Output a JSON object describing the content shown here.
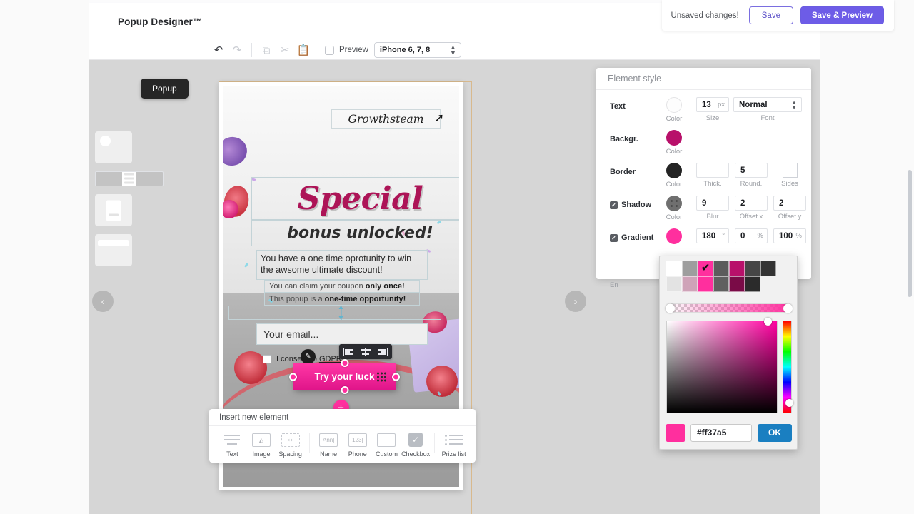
{
  "app": {
    "title": "Popup Designer™"
  },
  "toolbar": {
    "undo_icon": "undo-icon",
    "redo_icon": "redo-icon",
    "copy_icon": "copy-icon",
    "cut_icon": "cut-icon",
    "paste_icon": "paste-icon",
    "preview_label": "Preview",
    "device": "iPhone 6, 7, 8"
  },
  "savebar": {
    "status": "Unsaved changes!",
    "save_label": "Save",
    "save_preview_label": "Save & Preview",
    "accent": "#6d5ce7"
  },
  "rail": {
    "tooltip": "Popup",
    "prev_arrow": "‹",
    "next_arrow": "›"
  },
  "popup": {
    "logo": "Growthsteam",
    "headline": "Special",
    "subheadline": "bonus unlocked!",
    "paragraph": "You have a one time oprotunity to win the awsome ultimate discount!",
    "mini_line_1_prefix": "You can claim your coupon ",
    "mini_line_1_bold": "only once!",
    "mini_line_2_prefix": "This popup is a ",
    "mini_line_2_bold": "one-time opportunity!",
    "email_placeholder": "Your email...",
    "gdpr_prefix": "I consent to ",
    "gdpr_link": "GDPR",
    "cta_label": "Try your luck",
    "cta_color": "#ff37a5",
    "add_element_glyph": "+",
    "edit_glyph": "✎"
  },
  "align_toolbar": {
    "items": [
      {
        "name": "align-left-icon"
      },
      {
        "name": "align-center-icon"
      },
      {
        "name": "align-right-icon"
      }
    ]
  },
  "insert_panel": {
    "title": "Insert new element",
    "items": [
      {
        "label": "Text",
        "icon": "text-icon"
      },
      {
        "label": "Image",
        "icon": "image-icon"
      },
      {
        "label": "Spacing",
        "icon": "spacing-icon"
      },
      {
        "label": "Name",
        "icon": "name-field-icon",
        "sample": "Ann|"
      },
      {
        "label": "Phone",
        "icon": "phone-field-icon",
        "sample": "123|"
      },
      {
        "label": "Custom",
        "icon": "custom-field-icon",
        "sample": "|"
      },
      {
        "label": "Checkbox",
        "icon": "checkbox-icon"
      },
      {
        "label": "Prize list",
        "icon": "prize-list-icon"
      }
    ]
  },
  "style_panel": {
    "title": "Element style",
    "rows": {
      "text": {
        "label": "Text",
        "color_label": "Color",
        "color": "#ffffff",
        "size_value": "13",
        "size_unit": "px",
        "size_label": "Size",
        "font_value": "Normal",
        "font_label": "Font"
      },
      "background": {
        "label": "Backgr.",
        "color_label": "Color",
        "color": "#b8106a"
      },
      "border": {
        "label": "Border",
        "color_label": "Color",
        "color": "#242424",
        "thick_value": "",
        "thick_label": "Thick.",
        "round_value": "5",
        "round_label": "Round.",
        "sides_label": "Sides"
      },
      "shadow": {
        "label": "Shadow",
        "enabled": true,
        "color_label": "Color",
        "color": "#6f6f6f",
        "blur_value": "9",
        "blur_label": "Blur",
        "offset_x_value": "2",
        "offset_x_label": "Offset x",
        "offset_y_value": "2",
        "offset_y_label": "Offset y"
      },
      "gradient": {
        "label": "Gradient",
        "enabled": true,
        "color": "#ff2f9e",
        "angle_value": "180",
        "angle_unit": "°",
        "start_value": "0",
        "start_unit": "%",
        "end_value": "100",
        "end_unit": "%",
        "end_label": "En"
      }
    }
  },
  "color_picker": {
    "hex": "#ff37a5",
    "ok_label": "OK",
    "selected_index": 2,
    "swatches_row1": [
      "#ffffff",
      "#9e9e9e",
      "#ff2f9e",
      "#5c5c5c",
      "#b8106a",
      "#464646",
      "#333333"
    ],
    "swatches_row2": [
      "#e3e3e3",
      "#cfa3b8",
      "#ff2f9e",
      "#606060",
      "#7a0b47",
      "#2b2b2b"
    ],
    "current_color": "#ff2f9e"
  }
}
